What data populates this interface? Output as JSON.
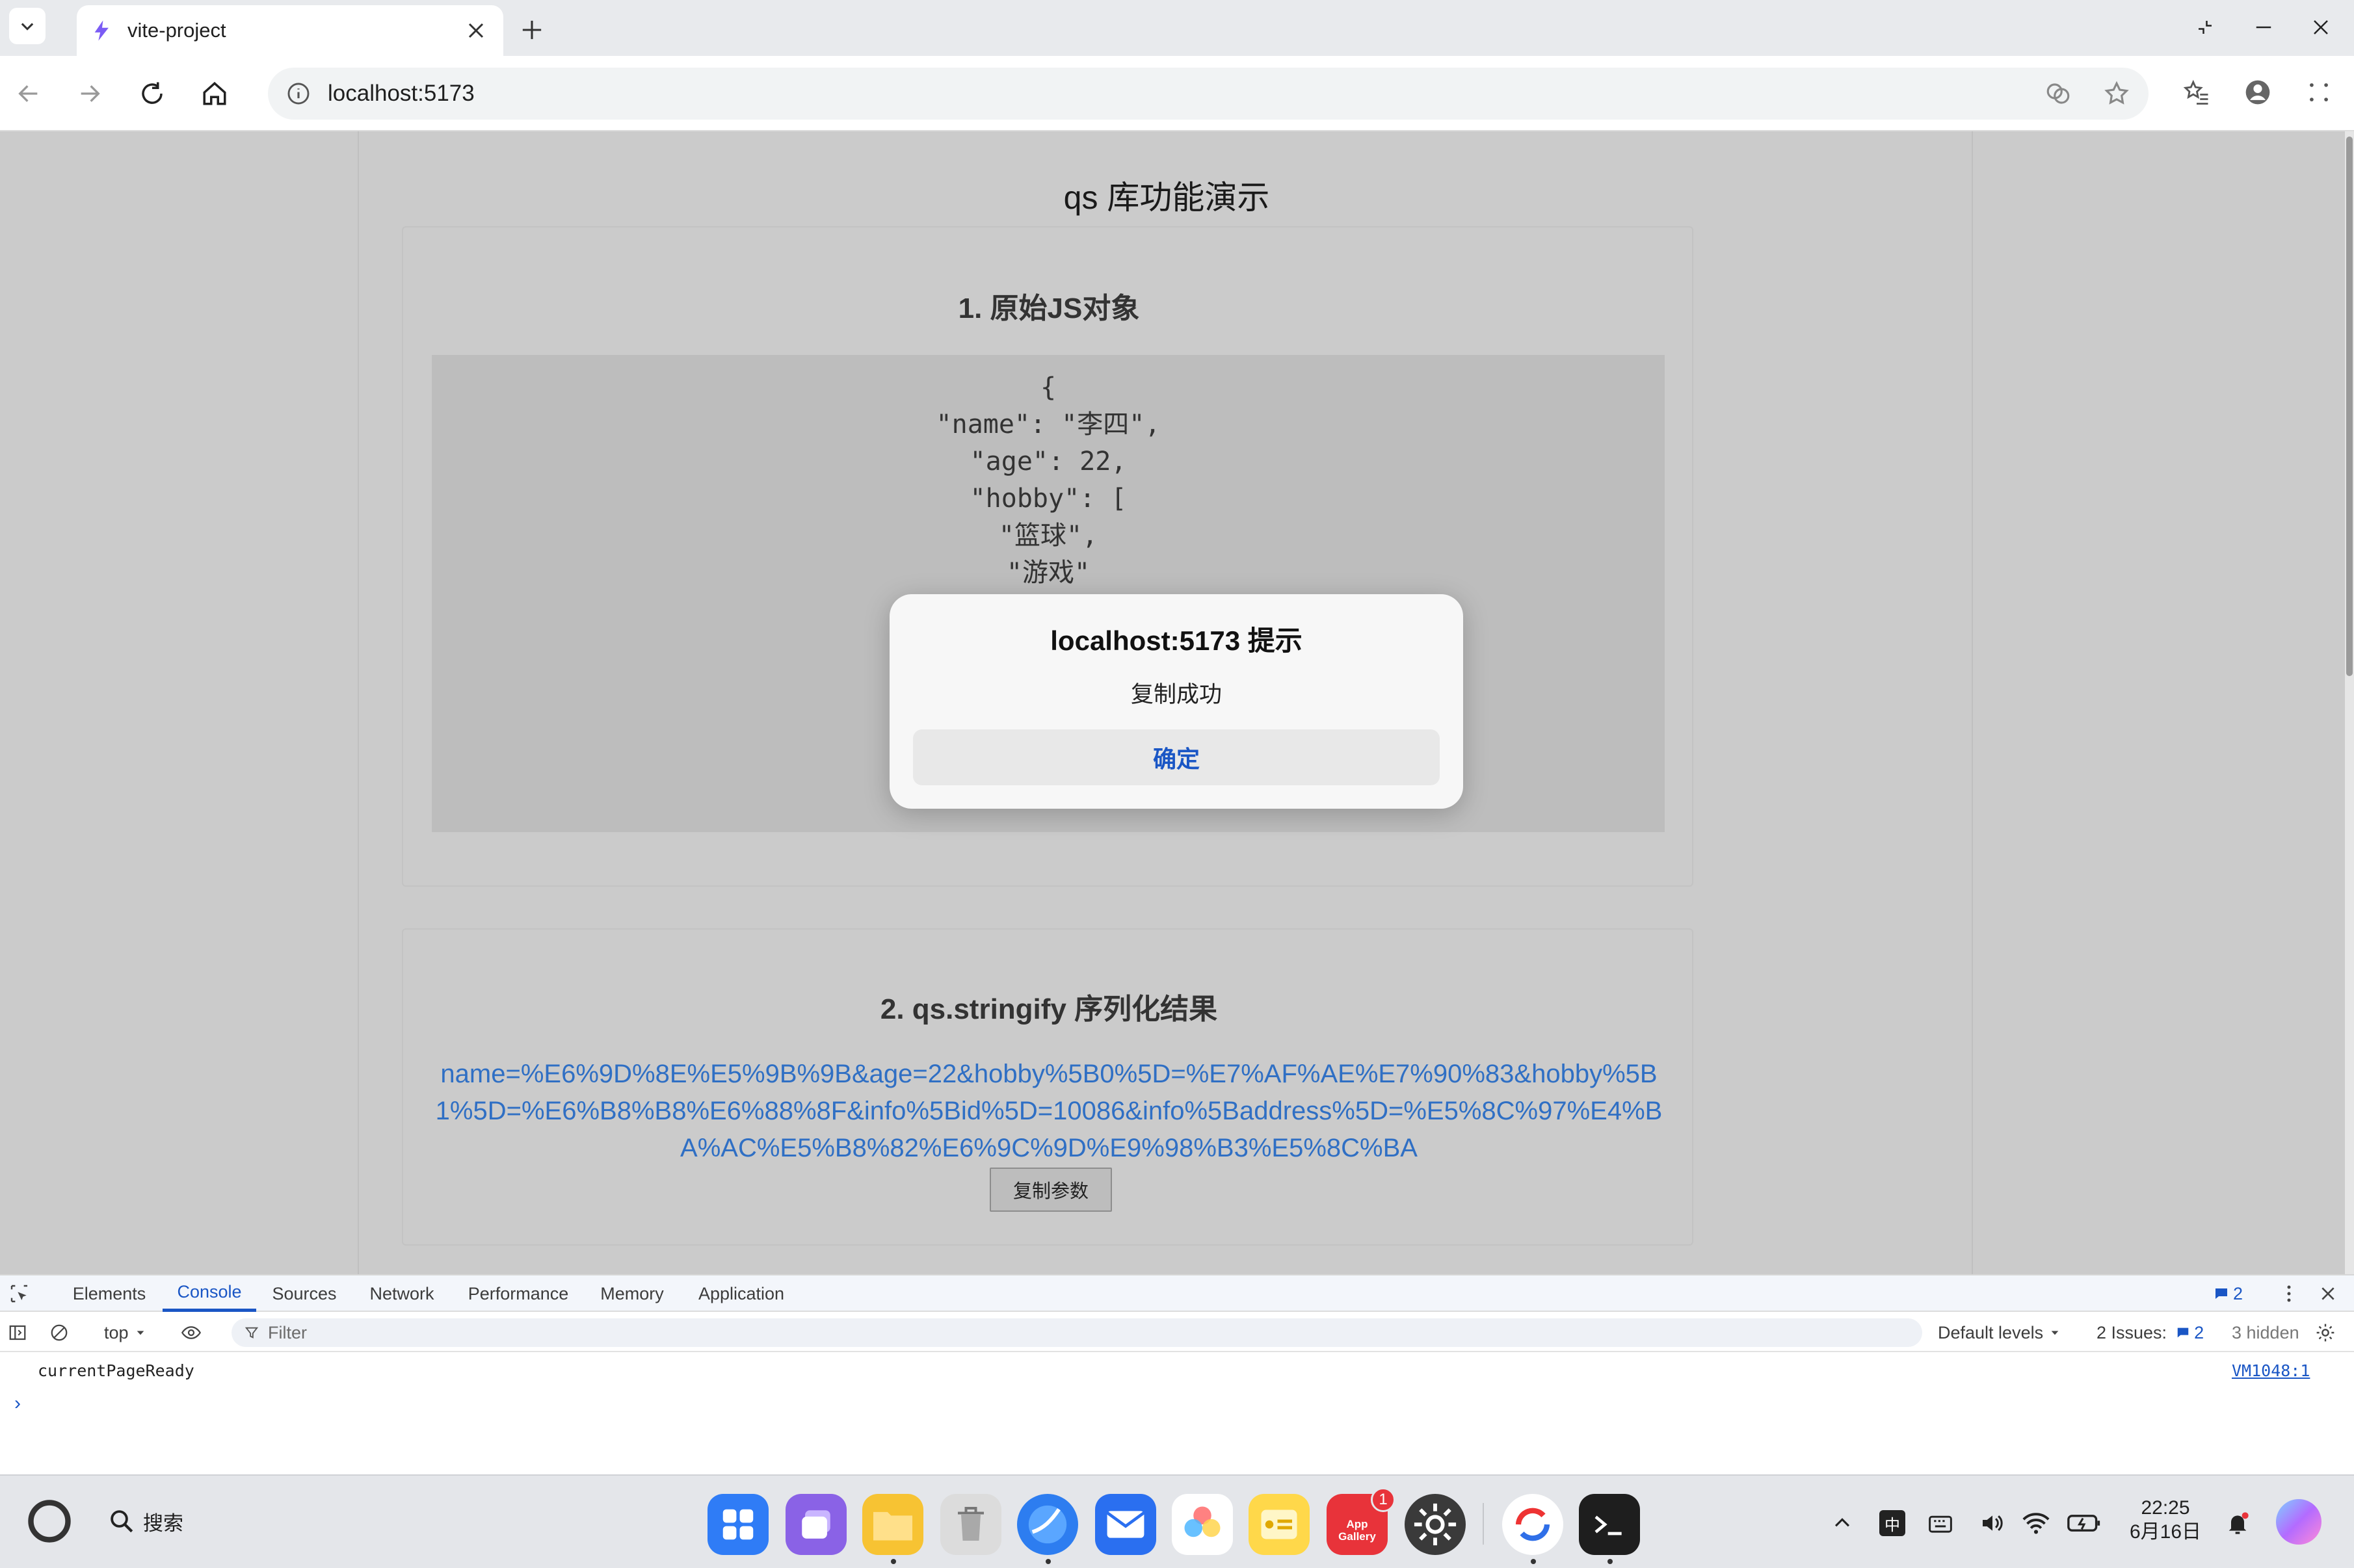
{
  "browser": {
    "tab_title": "vite-project",
    "url": "localhost:5173"
  },
  "page": {
    "title": "qs 库功能演示",
    "section1": {
      "title": "1. 原始JS对象",
      "code_lines": [
        "{",
        "\"name\": \"李四\",",
        "\"age\": 22,",
        "\"hobby\": [",
        "\"篮球\",",
        "\"游戏\"",
        "",
        "",
        "",
        "",
        "",
        "}"
      ]
    },
    "section2": {
      "title": "2. qs.stringify 序列化结果",
      "result": "name=%E6%9D%8E%E5%9B%9B&age=22&hobby%5B0%5D=%E7%AF%AE%E7%90%83&hobby%5B1%5D=%E6%B8%B8%E6%88%8F&info%5Bid%5D=10086&info%5Baddress%5D=%E5%8C%97%E4%BA%AC%E5%B8%82%E6%9C%9D%E9%98%B3%E5%8C%BA",
      "copy_button": "复制参数"
    }
  },
  "dialog": {
    "title": "localhost:5173 提示",
    "message": "复制成功",
    "ok_label": "确定"
  },
  "devtools": {
    "tabs": [
      "Elements",
      "Console",
      "Sources",
      "Network",
      "Performance",
      "Memory",
      "Application"
    ],
    "active_tab": "Console",
    "message_count": "2",
    "context": "top",
    "filter_placeholder": "Filter",
    "levels": "Default levels",
    "issues_label": "2 Issues:",
    "issues_count": "2",
    "hidden": "3 hidden",
    "log_message": "currentPageReady",
    "log_source": "VM1048:1",
    "prompt": "›"
  },
  "taskbar": {
    "search_label": "搜索",
    "time": "22:25",
    "date": "6月16日",
    "ime": "中",
    "app_gallery_badge": "1",
    "app_gallery_label": "App Gallery"
  },
  "colors": {
    "accent": "#1a56c5",
    "link": "#2f6fc4",
    "page_bg": "#cbcbcb"
  }
}
